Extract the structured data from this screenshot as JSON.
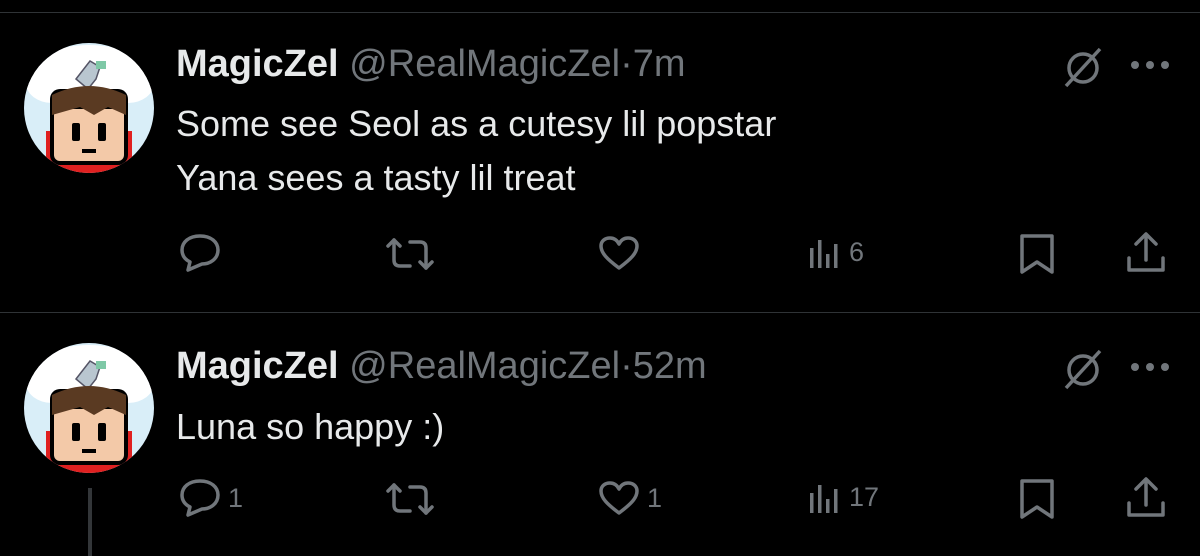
{
  "posts": [
    {
      "author_name": "MagicZel",
      "handle": "@RealMagicZel",
      "separator": "·",
      "time": "7m",
      "lines": [
        "Some see Seol as a cutesy lil popstar",
        "Yana sees a tasty lil treat"
      ],
      "replies": "",
      "reposts": "",
      "likes": "",
      "views": "6"
    },
    {
      "author_name": "MagicZel",
      "handle": "@RealMagicZel",
      "separator": "·",
      "time": "52m",
      "lines": [
        "Luna so happy :)"
      ],
      "replies": "1",
      "reposts": "",
      "likes": "1",
      "views": "17"
    }
  ],
  "icons": {
    "grok": "grok-slash-circle-icon",
    "more": "more-dots-icon",
    "reply": "reply-bubble-icon",
    "repost": "repost-icon",
    "like": "heart-icon",
    "views": "views-bars-icon",
    "bookmark": "bookmark-icon",
    "share": "share-upload-icon"
  },
  "colors": {
    "background": "#000000",
    "primary_text": "#e7e9ea",
    "secondary_text": "#71767b",
    "divider": "#2f3336"
  }
}
